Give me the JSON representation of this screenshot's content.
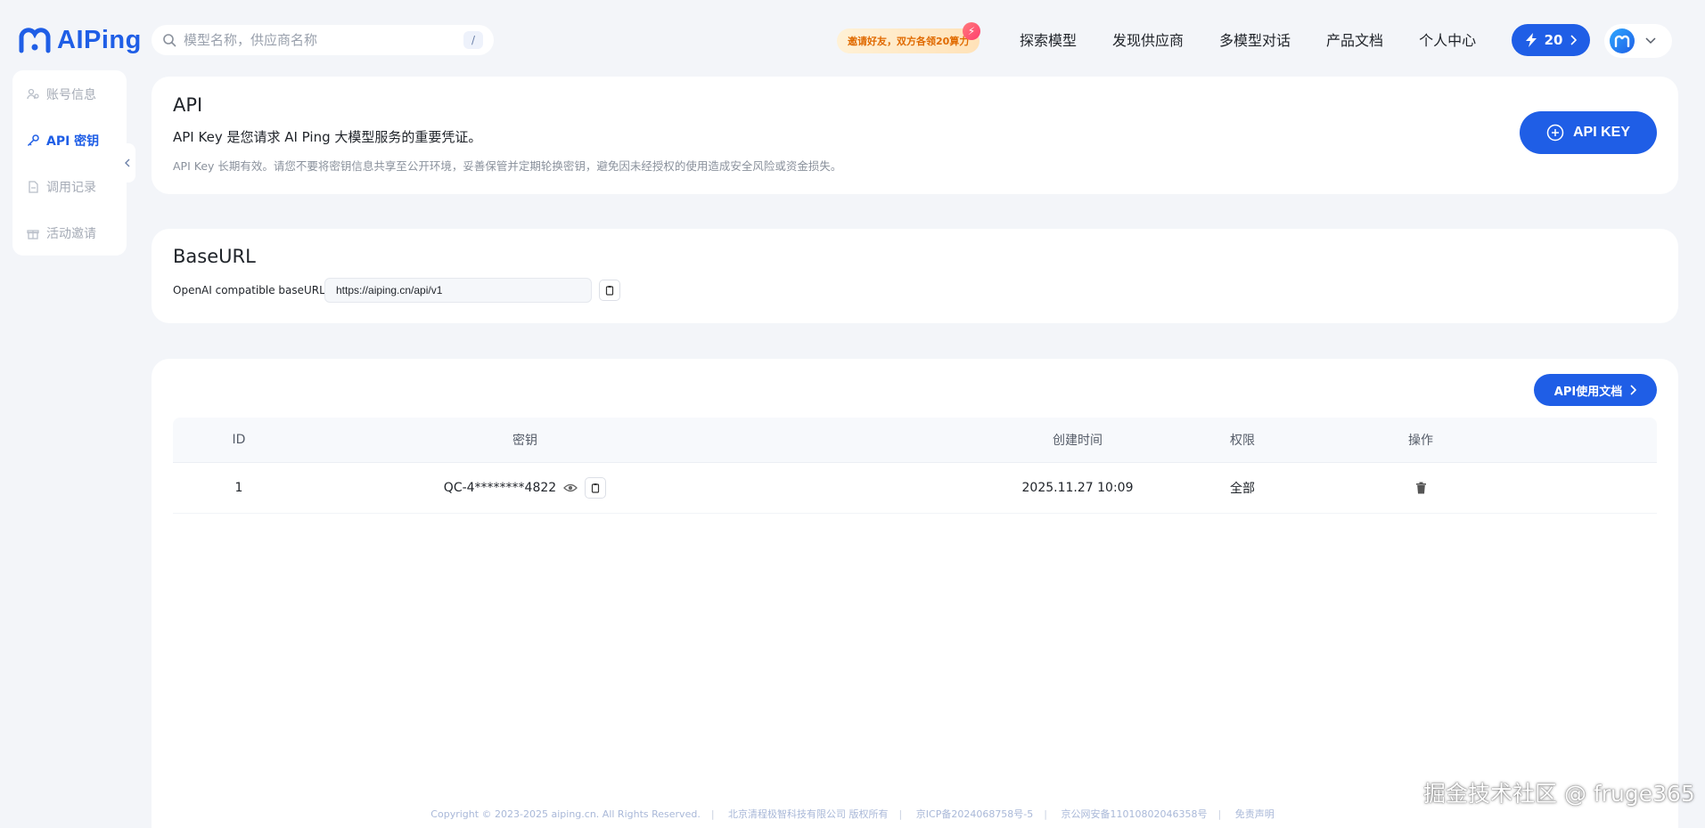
{
  "header": {
    "logo_text": "AIPing",
    "search_placeholder": "模型名称，供应商名称",
    "search_shortcut": "/",
    "promo_text": "邀请好友，双方各领20算力",
    "nav": [
      "探索模型",
      "发现供应商",
      "多模型对话",
      "产品文档",
      "个人中心"
    ],
    "credits": "20"
  },
  "sidebar": {
    "items": [
      {
        "label": "账号信息",
        "icon": "user-settings-icon",
        "active": false
      },
      {
        "label": "API 密钥",
        "icon": "key-icon",
        "active": true
      },
      {
        "label": "调用记录",
        "icon": "document-icon",
        "active": false
      },
      {
        "label": "活动邀请",
        "icon": "gift-icon",
        "active": false
      }
    ]
  },
  "api_card": {
    "title": "API",
    "description": "API Key 是您请求 AI Ping 大模型服务的重要凭证。",
    "note": "API Key 长期有效。请您不要将密钥信息共享至公开环境，妥善保管并定期轮换密钥，避免因未经授权的使用造成安全风险或资金损失。",
    "button": "API KEY"
  },
  "base_card": {
    "title": "BaseURL",
    "label": "OpenAI compatible baseURL:",
    "value": "https://aiping.cn/api/v1"
  },
  "keys_card": {
    "doc_button": "API使用文档",
    "columns": [
      "ID",
      "密钥",
      "创建时间",
      "权限",
      "操作"
    ],
    "rows": [
      {
        "id": "1",
        "key": "QC-4********4822",
        "created": "2025.11.27 10:09",
        "permission": "全部"
      }
    ]
  },
  "footer": {
    "items": [
      "Copyright © 2023-2025 aiping.cn. All Rights Reserved.",
      "北京清程极智科技有限公司 版权所有",
      "京ICP备2024068758号-5",
      "京公网安备11010802046358号",
      "免责声明"
    ]
  },
  "watermark": "掘金技术社区 @ fruge365",
  "colors": {
    "accent": "#1f5ee6",
    "background": "#f3f5f9",
    "promo": "#e06a00"
  }
}
